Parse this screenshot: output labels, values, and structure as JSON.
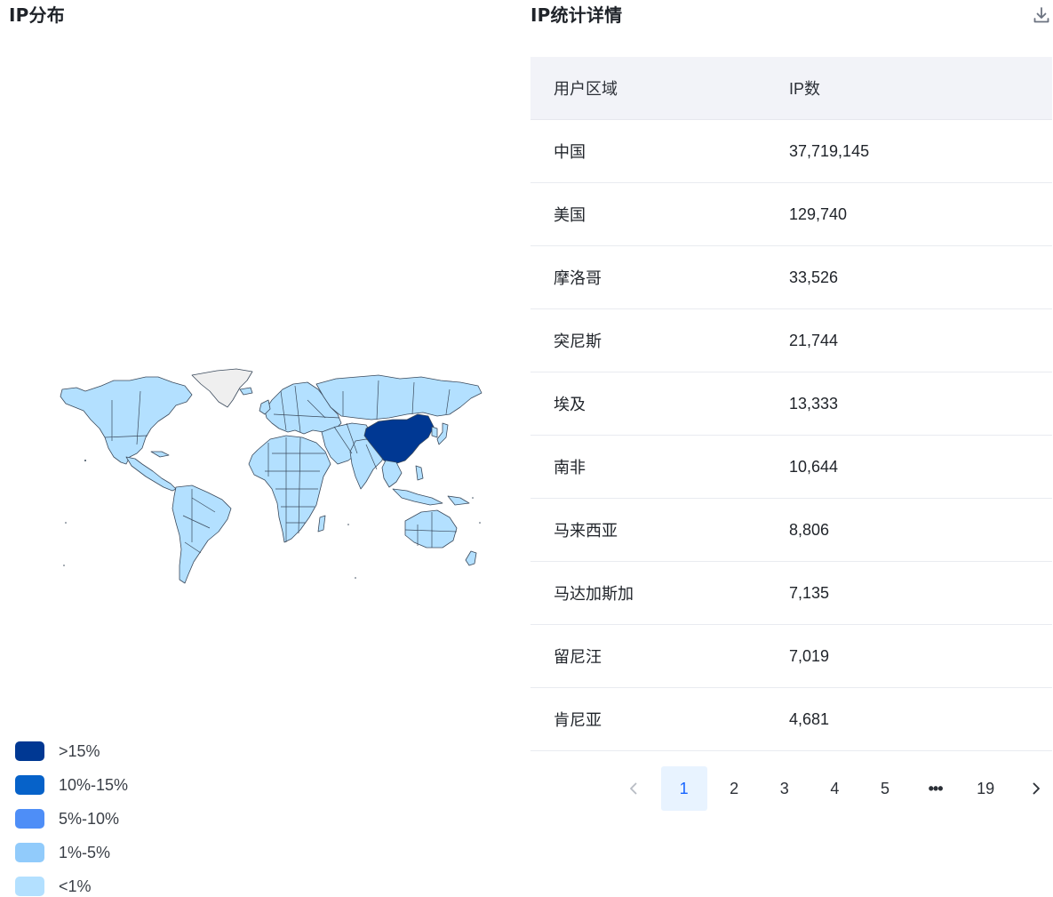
{
  "map_panel": {
    "title": "IP分布",
    "legend": [
      {
        "label": ">15%",
        "color": "#003893"
      },
      {
        "label": "10%-15%",
        "color": "#0662c9"
      },
      {
        "label": "5%-10%",
        "color": "#4e8ef7"
      },
      {
        "label": "1%-5%",
        "color": "#91cbfb"
      },
      {
        "label": "<1%",
        "color": "#b3e0ff"
      }
    ],
    "colors": {
      "highlight": "#003893",
      "default_land": "#b3e0ff",
      "no_data": "#efefef"
    }
  },
  "table_panel": {
    "title": "IP统计详情",
    "download_icon": "download-icon",
    "columns": [
      "用户区域",
      "IP数"
    ],
    "rows": [
      {
        "region": "中国",
        "ip_count": "37,719,145"
      },
      {
        "region": "美国",
        "ip_count": "129,740"
      },
      {
        "region": "摩洛哥",
        "ip_count": "33,526"
      },
      {
        "region": "突尼斯",
        "ip_count": "21,744"
      },
      {
        "region": "埃及",
        "ip_count": "13,333"
      },
      {
        "region": "南非",
        "ip_count": "10,644"
      },
      {
        "region": "马来西亚",
        "ip_count": "8,806"
      },
      {
        "region": "马达加斯加",
        "ip_count": "7,135"
      },
      {
        "region": "留尼汪",
        "ip_count": "7,019"
      },
      {
        "region": "肯尼亚",
        "ip_count": "4,681"
      }
    ]
  },
  "pagination": {
    "prev_icon": "chevron-left-icon",
    "next_icon": "chevron-right-icon",
    "pages": [
      "1",
      "2",
      "3",
      "4",
      "5",
      "•••",
      "19"
    ],
    "current": "1"
  }
}
